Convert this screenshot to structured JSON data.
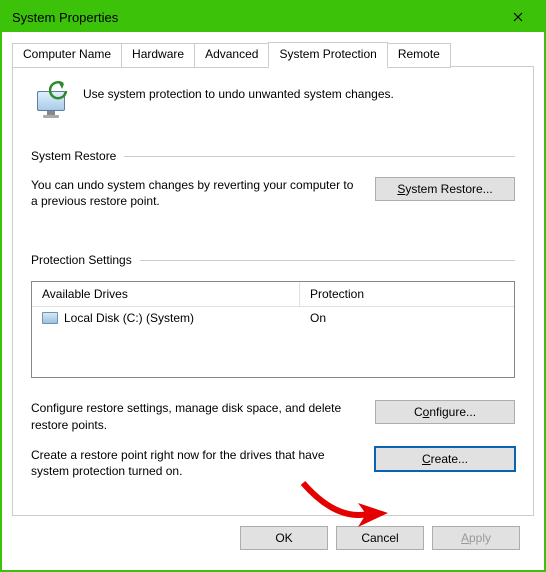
{
  "window": {
    "title": "System Properties"
  },
  "tabs": {
    "items": [
      {
        "label": "Computer Name"
      },
      {
        "label": "Hardware"
      },
      {
        "label": "Advanced"
      },
      {
        "label": "System Protection"
      },
      {
        "label": "Remote"
      }
    ],
    "active_index": 3
  },
  "intro": {
    "text": "Use system protection to undo unwanted system changes."
  },
  "system_restore": {
    "heading": "System Restore",
    "desc": "You can undo system changes by reverting your computer to a previous restore point.",
    "button_prefix": "",
    "button_underlined": "S",
    "button_suffix": "ystem Restore..."
  },
  "protection_settings": {
    "heading": "Protection Settings",
    "columns": {
      "drive": "Available Drives",
      "protection": "Protection"
    },
    "rows": [
      {
        "drive": "Local Disk (C:) (System)",
        "protection": "On"
      }
    ],
    "configure_desc": "Configure restore settings, manage disk space, and delete restore points.",
    "configure_prefix": "C",
    "configure_underlined": "o",
    "configure_suffix": "nfigure...",
    "create_desc": "Create a restore point right now for the drives that have system protection turned on.",
    "create_prefix": "",
    "create_underlined": "C",
    "create_suffix": "reate..."
  },
  "footer": {
    "ok": "OK",
    "cancel": "Cancel",
    "apply_prefix": "",
    "apply_underlined": "A",
    "apply_suffix": "pply"
  }
}
